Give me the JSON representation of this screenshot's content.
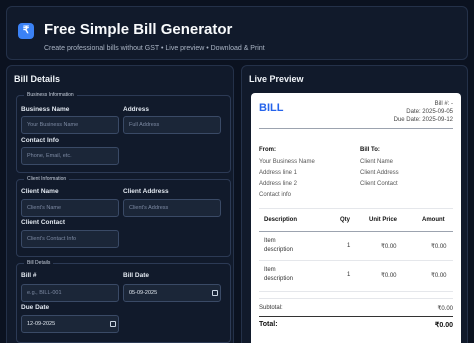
{
  "app": {
    "logo_glyph": "₹",
    "title": "Free Simple Bill Generator",
    "subtitle": "Create professional bills without GST • Live preview • Download & Print"
  },
  "bill_details": {
    "title": "Bill Details",
    "business": {
      "legend": "Business Information",
      "name_label": "Business Name",
      "name_placeholder": "Your Business Name",
      "address_label": "Address",
      "address_placeholder": "Full Address",
      "contact_label": "Contact Info",
      "contact_placeholder": "Phone, Email, etc."
    },
    "client": {
      "legend": "Client Information",
      "name_label": "Client Name",
      "name_placeholder": "Client's Name",
      "address_label": "Client Address",
      "address_placeholder": "Client's Address",
      "contact_label": "Client Contact",
      "contact_placeholder": "Client's Contact Info"
    },
    "bill": {
      "legend": "Bill Details",
      "number_label": "Bill #",
      "number_placeholder": "e.g., BILL-001",
      "date_label": "Bill Date",
      "date_value": "05-09-2025",
      "due_label": "Due Date",
      "due_value": "12-09-2025"
    }
  },
  "preview": {
    "title": "Live Preview",
    "bill_word": "BILL",
    "bill_number": "Bill #: -",
    "date": "Date: 2025-09-05",
    "due_date": "Due Date: 2025-09-12",
    "from": {
      "title": "From:",
      "lines": [
        "Your Business Name",
        "Address line 1",
        "Address line 2",
        "Contact info"
      ]
    },
    "to": {
      "title": "Bill To:",
      "lines": [
        "Client Name",
        "Client Address",
        "Client Contact"
      ]
    },
    "table": {
      "headers": [
        "Description",
        "Qty",
        "Unit Price",
        "Amount"
      ],
      "rows": [
        {
          "desc1": "Item",
          "desc2": "description",
          "qty": "1",
          "price": "₹0.00",
          "amount": "₹0.00"
        },
        {
          "desc1": "Item",
          "desc2": "description",
          "qty": "1",
          "price": "₹0.00",
          "amount": "₹0.00"
        }
      ]
    },
    "subtotal_label": "Subtotal:",
    "subtotal_value": "₹0.00",
    "total_label": "Total:",
    "total_value": "₹0.00"
  },
  "colors": {
    "background": "#0b1220",
    "panel": "#111a2b",
    "accent": "#2563eb"
  }
}
